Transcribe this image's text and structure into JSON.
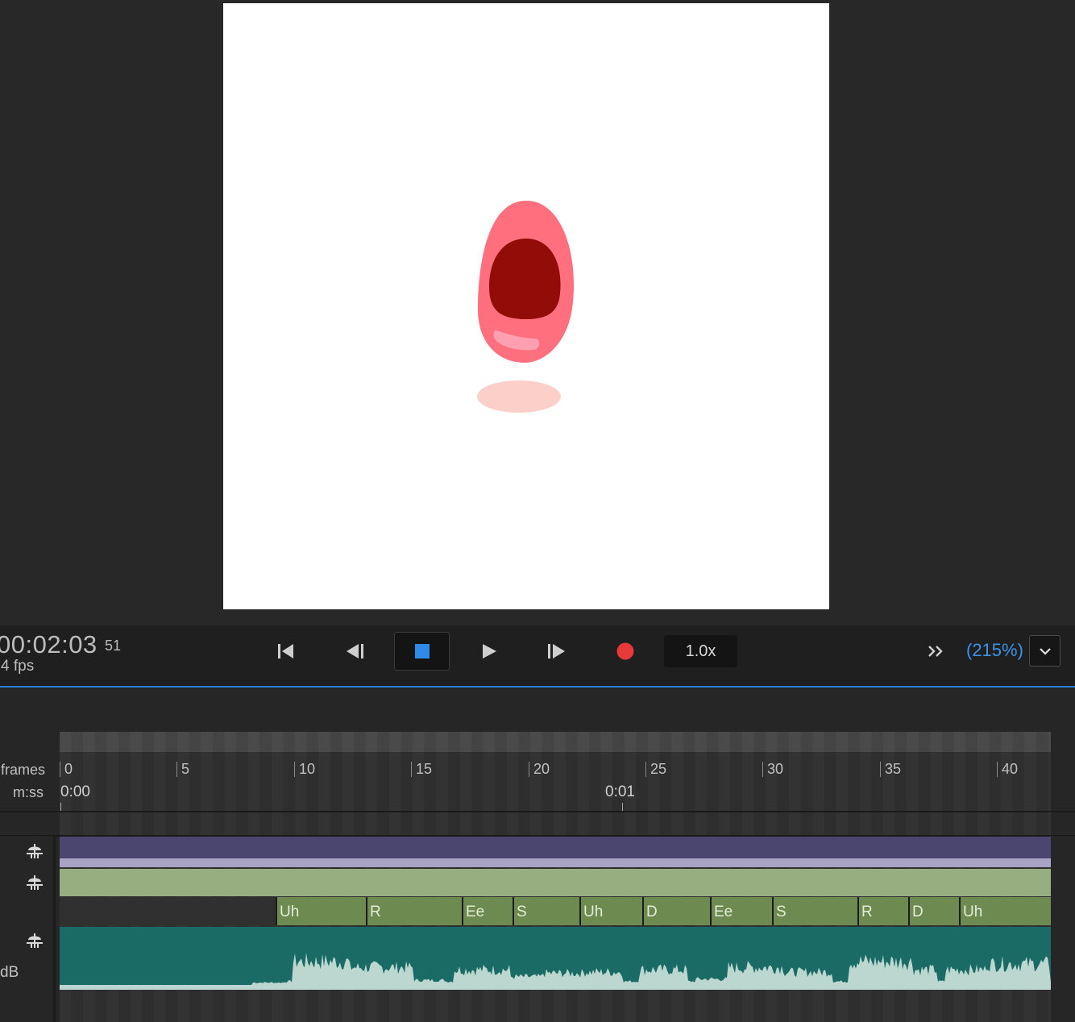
{
  "transport": {
    "timecode": "00:02:03",
    "frame": "51",
    "fps": "4 fps",
    "speed": "1.0x",
    "zoom": "(215%)",
    "record_color": "#e8393a",
    "stop_color": "#2f8be8"
  },
  "timeline": {
    "frames_label": "frames",
    "mss_label": "m:ss",
    "frame_ticks": [
      "0",
      "5",
      "10",
      "15",
      "20",
      "25",
      "30",
      "35",
      "40"
    ],
    "time_ticks": [
      "0:00",
      "0:01"
    ],
    "db_label": "dB",
    "visemes": [
      "Uh",
      "R",
      "Ee",
      "S",
      "Uh",
      "D",
      "Ee",
      "S",
      "R",
      "D",
      "Uh"
    ],
    "track_colors": {
      "puppet": "#4a4670",
      "trigger": "#96ae80",
      "viseme": "#6d8a50",
      "audio": "#1a6b66"
    }
  },
  "icons": {
    "first_frame": "skip-to-start-icon",
    "prev_frame": "step-back-icon",
    "stop": "stop-icon",
    "play": "play-icon",
    "next_frame": "step-forward-icon",
    "record": "record-icon",
    "more": "double-chevron-icon",
    "dropdown": "chevron-down-icon",
    "track": "puppet-track-icon"
  }
}
